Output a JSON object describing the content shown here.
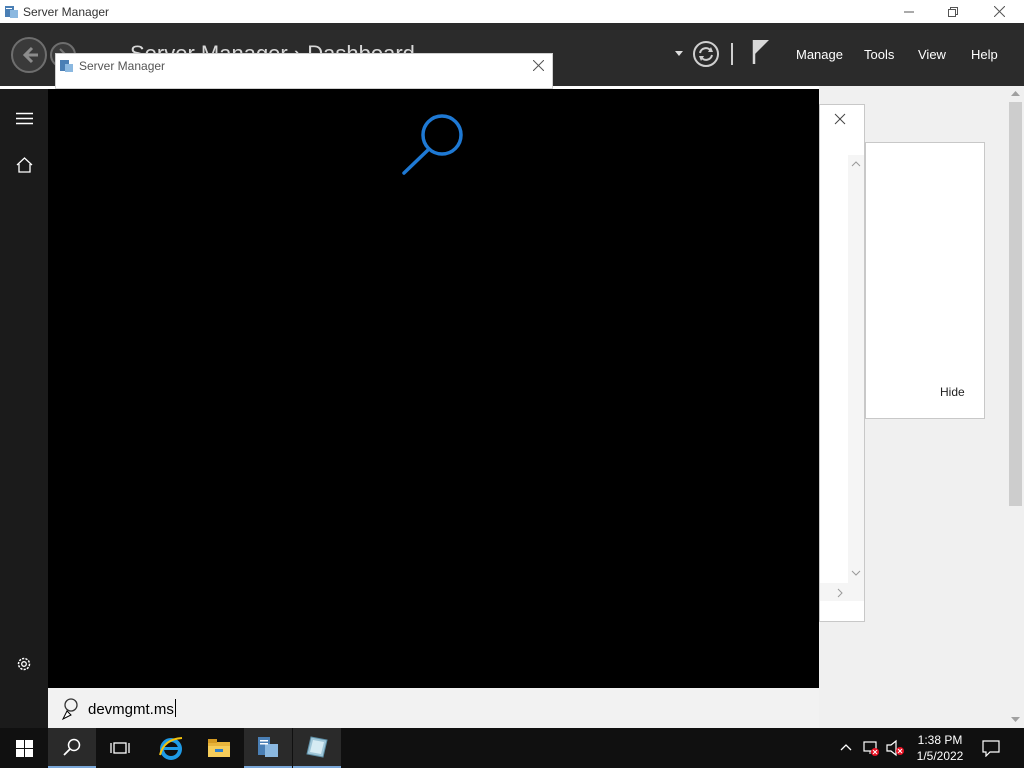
{
  "window": {
    "title": "Server Manager",
    "header_breadcrumb": "Server Manager › Dashboard",
    "menu": [
      "Manage",
      "Tools",
      "View",
      "Help"
    ]
  },
  "overlay_window": {
    "title": "Server Manager"
  },
  "content": {
    "hide_label": "Hide"
  },
  "search": {
    "query": "devmgmt.ms"
  },
  "taskbar": {
    "time": "1:38 PM",
    "date": "1/5/2022"
  },
  "colors": {
    "header_bg": "#2b2b2b",
    "search_panel_bg": "#000000",
    "search_icon_accent": "#1e79d4",
    "taskbar_bg": "#101010"
  },
  "icons": [
    "server-manager-icon",
    "back-arrow-icon",
    "forward-arrow-icon",
    "refresh-icon",
    "notifications-flag-icon",
    "hamburger-menu-icon",
    "home-icon",
    "settings-gear-icon",
    "search-magnifier-icon",
    "cortana-icon",
    "windows-start-icon",
    "task-view-icon",
    "internet-explorer-icon",
    "file-explorer-icon",
    "network-icon",
    "volume-icon",
    "action-center-icon"
  ]
}
